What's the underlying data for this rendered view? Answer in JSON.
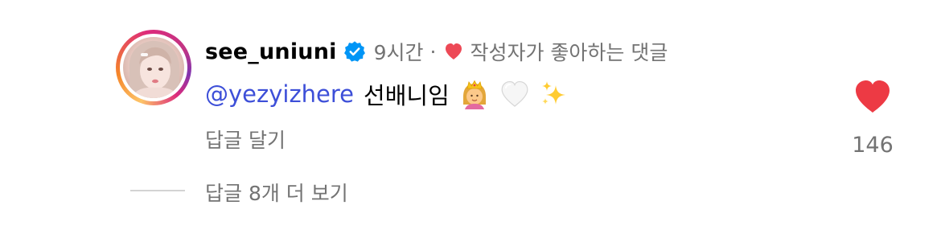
{
  "comment": {
    "username": "see_uniuni",
    "verified": true,
    "time": "9시간",
    "separator": "·",
    "liked_by_creator": "작성자가 좋아하는 댓글",
    "mention": "@yezyizhere",
    "text": "선배니임",
    "emojis": [
      "princess-emoji",
      "white-heart-emoji",
      "sparkles-emoji"
    ],
    "reply_label": "답글 달기",
    "like_count": "146",
    "liked": true,
    "view_replies_label": "답글 8개 더 보기"
  },
  "colors": {
    "like_red": "#ed4956",
    "verified_blue": "#0095f6",
    "mention_blue": "#3d4fd8",
    "secondary_text": "#737373"
  }
}
